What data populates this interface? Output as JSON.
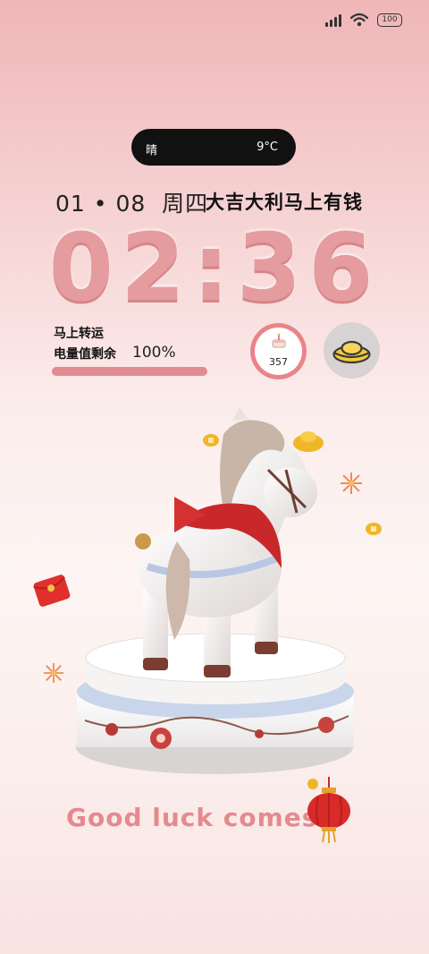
{
  "status": {
    "battery": "100"
  },
  "weather": {
    "condition": "晴",
    "temperature": "9°C"
  },
  "date": {
    "text": "01 • 08  周四"
  },
  "slogan": "大吉大利马上有钱",
  "clock": {
    "time": "02:36"
  },
  "fortune": {
    "title": "马上转运",
    "label": "电量值剩余",
    "value": "100%",
    "progress_percent": 100
  },
  "steps_widget": {
    "value": "357"
  },
  "tagline": "Good luck comes",
  "colors": {
    "accent": "#e18c91",
    "clock": "#e59c9f",
    "pill": "#111111"
  },
  "icons": [
    "signal-icon",
    "wifi-icon",
    "battery-icon",
    "cake-icon",
    "gold-ingot-icon",
    "red-envelope-icon",
    "lantern-icon",
    "coin-icon",
    "firework-icon"
  ]
}
